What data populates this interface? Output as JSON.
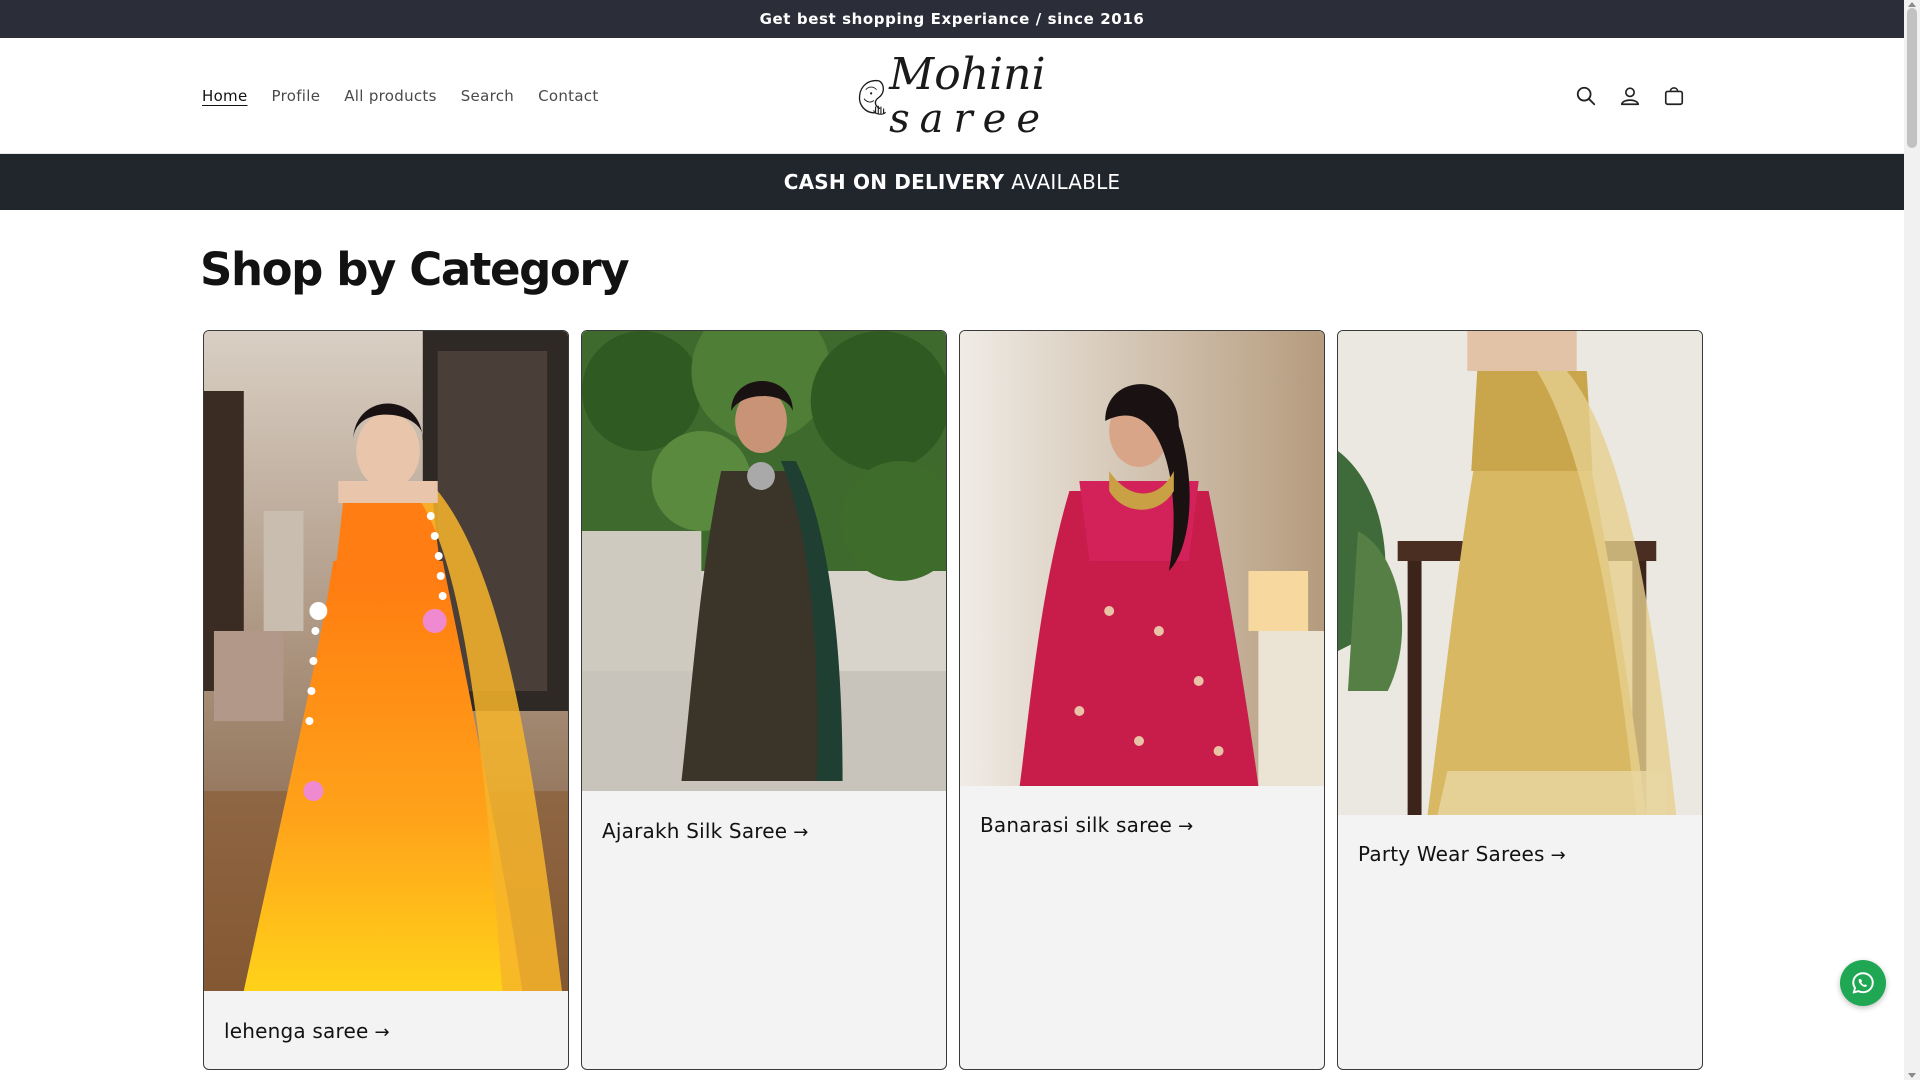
{
  "announcement": {
    "text": "Get best shopping Experiance / since 2016"
  },
  "nav": {
    "items": [
      {
        "label": "Home",
        "active": true
      },
      {
        "label": "Profile"
      },
      {
        "label": "All products"
      },
      {
        "label": "Search"
      },
      {
        "label": "Contact"
      }
    ]
  },
  "logo": {
    "line1": "Mohini",
    "line2": "saree"
  },
  "header_icons": [
    "search-icon",
    "account-icon",
    "cart-icon"
  ],
  "cod_bar": {
    "bold": "CASH ON DELIVERY",
    "rest": "AVAILABLE"
  },
  "section": {
    "title": "Shop by Category"
  },
  "categories": [
    {
      "label": "lehenga saree",
      "arrow": "→",
      "theme": "orange-yellow lehenga"
    },
    {
      "label": "Ajarakh Silk Saree",
      "arrow": "→",
      "theme": "dark green printed saree"
    },
    {
      "label": "Banarasi silk saree",
      "arrow": "→",
      "theme": "pink banarasi saree"
    },
    {
      "label": "Party Wear Sarees",
      "arrow": "→",
      "theme": "gold tissue saree"
    }
  ],
  "colors": {
    "announcement_bg": "#2b2e38",
    "cod_bg": "#21252c",
    "whatsapp": "#1fa754"
  }
}
